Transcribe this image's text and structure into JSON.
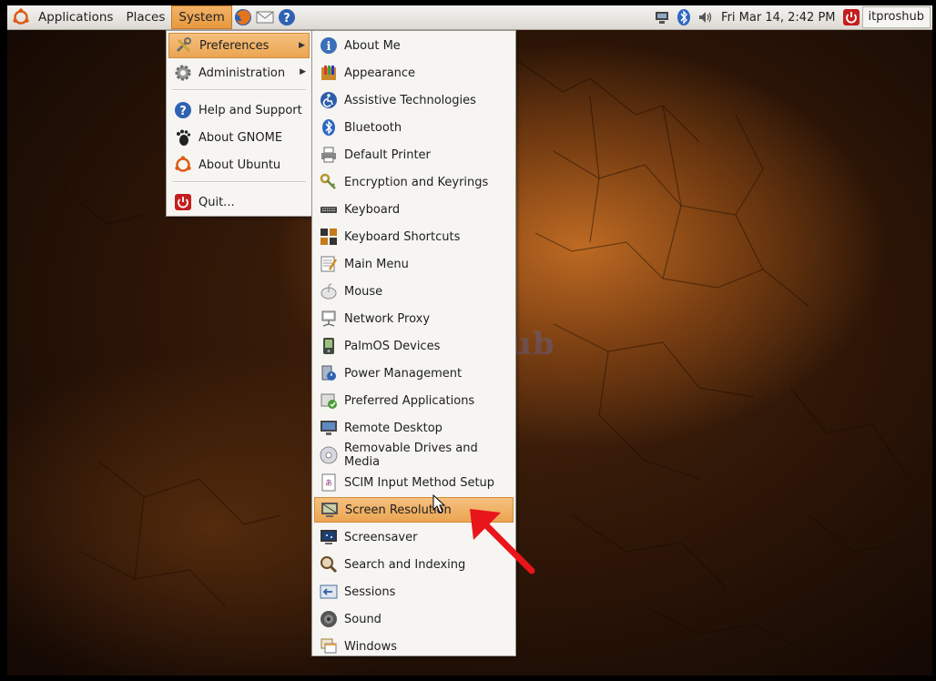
{
  "panel": {
    "menus": [
      "Applications",
      "Places",
      "System"
    ],
    "clock": "Fri Mar 14,  2:42 PM",
    "user": "itproshub",
    "launchers": [
      "firefox-icon",
      "mail-icon",
      "help-icon"
    ],
    "tray": [
      "network-icon",
      "bluetooth-icon",
      "volume-icon"
    ]
  },
  "system_menu": {
    "items": [
      {
        "label": "Preferences",
        "icon": "preferences-icon",
        "submenu": true
      },
      {
        "label": "Administration",
        "icon": "gear-icon",
        "submenu": true
      },
      {
        "label": "Help and Support",
        "icon": "help-icon"
      },
      {
        "label": "About GNOME",
        "icon": "gnome-foot-icon"
      },
      {
        "label": "About Ubuntu",
        "icon": "ubuntu-icon"
      },
      {
        "label": "Quit...",
        "icon": "power-icon"
      }
    ],
    "highlighted": "Preferences"
  },
  "preferences_menu": {
    "items": [
      {
        "label": "About Me",
        "icon": "about-me-icon"
      },
      {
        "label": "Appearance",
        "icon": "appearance-icon"
      },
      {
        "label": "Assistive Technologies",
        "icon": "accessibility-icon"
      },
      {
        "label": "Bluetooth",
        "icon": "bluetooth-icon"
      },
      {
        "label": "Default Printer",
        "icon": "printer-icon"
      },
      {
        "label": "Encryption and Keyrings",
        "icon": "keyring-icon"
      },
      {
        "label": "Keyboard",
        "icon": "keyboard-icon"
      },
      {
        "label": "Keyboard Shortcuts",
        "icon": "shortcuts-icon"
      },
      {
        "label": "Main Menu",
        "icon": "main-menu-icon"
      },
      {
        "label": "Mouse",
        "icon": "mouse-icon"
      },
      {
        "label": "Network Proxy",
        "icon": "network-proxy-icon"
      },
      {
        "label": "PalmOS Devices",
        "icon": "palm-icon"
      },
      {
        "label": "Power Management",
        "icon": "power-management-icon"
      },
      {
        "label": "Preferred Applications",
        "icon": "preferred-apps-icon"
      },
      {
        "label": "Remote Desktop",
        "icon": "remote-desktop-icon"
      },
      {
        "label": "Removable Drives and Media",
        "icon": "disc-icon"
      },
      {
        "label": "SCIM Input Method Setup",
        "icon": "scim-icon"
      },
      {
        "label": "Screen Resolution",
        "icon": "screen-resolution-icon"
      },
      {
        "label": "Screensaver",
        "icon": "screensaver-icon"
      },
      {
        "label": "Search and Indexing",
        "icon": "search-icon"
      },
      {
        "label": "Sessions",
        "icon": "sessions-icon"
      },
      {
        "label": "Sound",
        "icon": "sound-icon"
      },
      {
        "label": "Windows",
        "icon": "windows-icon"
      }
    ],
    "highlighted": "Screen Resolution"
  },
  "watermark": "IT Pros Hub",
  "colors": {
    "highlight": "#eba552",
    "panel_bg": "#e6e3de",
    "menu_bg": "#f6f5f2",
    "annotation_arrow": "#e8151b"
  }
}
